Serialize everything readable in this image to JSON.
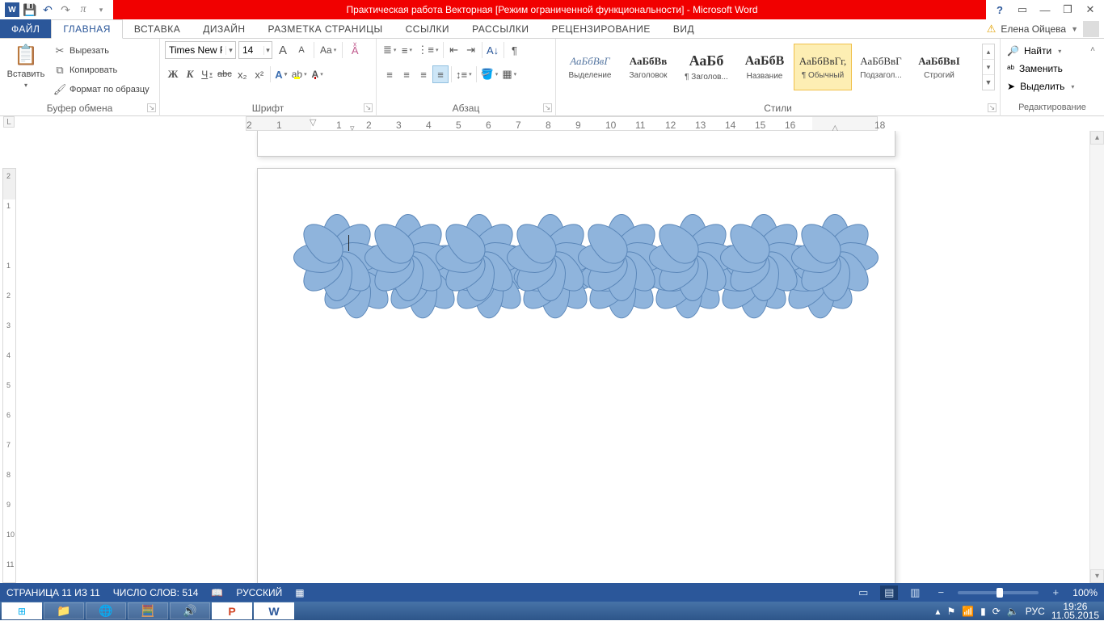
{
  "app": {
    "title": "Практическая работа Векторная [Режим ограниченной функциональности] -  Microsoft Word",
    "user_name": "Елена Ойцева"
  },
  "tabs": {
    "file": "ФАЙЛ",
    "items": [
      "ГЛАВНАЯ",
      "ВСТАВКА",
      "ДИЗАЙН",
      "РАЗМЕТКА СТРАНИЦЫ",
      "ССЫЛКИ",
      "РАССЫЛКИ",
      "РЕЦЕНЗИРОВАНИЕ",
      "ВИД"
    ],
    "active_index": 0
  },
  "clipboard": {
    "paste": "Вставить",
    "cut": "Вырезать",
    "copy": "Копировать",
    "format_painter": "Формат по образцу",
    "group": "Буфер обмена"
  },
  "font": {
    "name": "Times New R",
    "size": "14",
    "group": "Шрифт",
    "bold": "Ж",
    "italic": "К",
    "underline": "Ч",
    "strike": "abc",
    "sub": "x₂",
    "sup": "x²",
    "grow": "A",
    "shrink": "A",
    "case": "Aa",
    "clear": "⌫"
  },
  "paragraph": {
    "group": "Абзац"
  },
  "styles": {
    "group": "Стили",
    "items": [
      {
        "preview": "АаБбВвГ",
        "name": "Выделение",
        "cls": "it"
      },
      {
        "preview": "АаБбВв",
        "name": "Заголовок",
        "cls": "bd"
      },
      {
        "preview": "АаБб",
        "name": "¶ Заголов...",
        "cls": "big"
      },
      {
        "preview": "АаБбВ",
        "name": "Название",
        "cls": "big2"
      },
      {
        "preview": "АаБбВвГг,",
        "name": "¶ Обычный",
        "cls": ""
      },
      {
        "preview": "АаБбВвГ",
        "name": "Подзагол...",
        "cls": ""
      },
      {
        "preview": "АаБбВвІ",
        "name": "Строгий",
        "cls": "bd"
      }
    ],
    "selected_index": 4
  },
  "editing": {
    "find": "Найти",
    "replace": "Заменить",
    "select": "Выделить",
    "group": "Редактирование"
  },
  "ruler": {
    "marks": [
      "2",
      "1",
      "",
      "1",
      "2",
      "3",
      "4",
      "5",
      "6",
      "7",
      "8",
      "9",
      "10",
      "11",
      "12",
      "13",
      "14",
      "15",
      "16",
      "",
      "",
      "18"
    ]
  },
  "vruler": {
    "marks": [
      "2",
      "1",
      "",
      "1",
      "2",
      "3",
      "4",
      "5",
      "6",
      "7",
      "8",
      "9",
      "10",
      "11"
    ]
  },
  "status": {
    "page": "СТРАНИЦА 11 ИЗ 11",
    "words": "ЧИСЛО СЛОВ: 514",
    "lang": "РУССКИЙ",
    "zoom": "100%",
    "input_lang": "РУС"
  },
  "tray": {
    "time": "19:26",
    "date": "11.05.2015",
    "lang": "РУС"
  }
}
